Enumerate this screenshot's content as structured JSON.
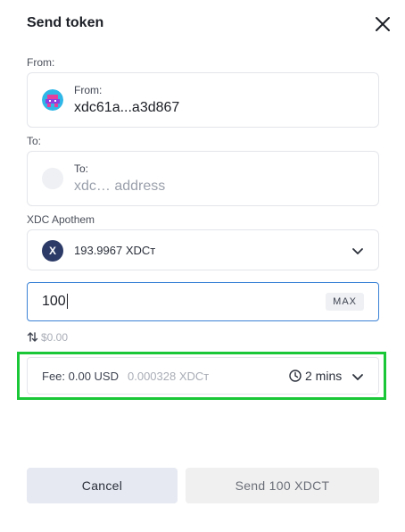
{
  "header": {
    "title": "Send token"
  },
  "from": {
    "section_label": "From:",
    "inner_label": "From:",
    "address": "xdc61a...a3d867"
  },
  "to": {
    "section_label": "To:",
    "inner_label": "To:",
    "placeholder": "xdc… address"
  },
  "network": {
    "label": "XDC Apothem",
    "balance": "193.9967 XDCт",
    "logo_letter": "X"
  },
  "amount": {
    "value": "100",
    "max_label": "MAX",
    "fiat": "$0.00"
  },
  "fee": {
    "label": "Fee: 0.00 USD",
    "native": "0.000328 XDCт",
    "time": "2 mins"
  },
  "buttons": {
    "cancel": "Cancel",
    "send": "Send 100 XDCT"
  },
  "colors": {
    "accent": "#3b82d6",
    "highlight": "#19c737",
    "xdc_logo": "#2b3a67"
  }
}
